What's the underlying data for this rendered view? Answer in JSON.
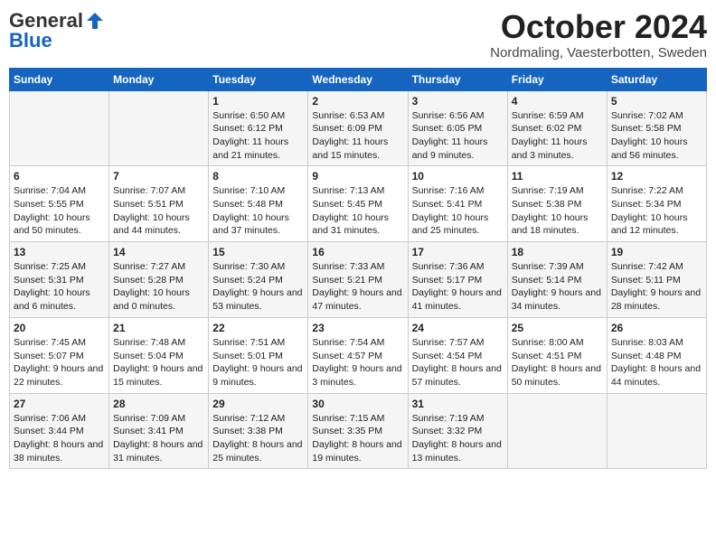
{
  "logo": {
    "general": "General",
    "blue": "Blue"
  },
  "title": "October 2024",
  "location": "Nordmaling, Vaesterbotten, Sweden",
  "days_of_week": [
    "Sunday",
    "Monday",
    "Tuesday",
    "Wednesday",
    "Thursday",
    "Friday",
    "Saturday"
  ],
  "weeks": [
    [
      {
        "day": "",
        "content": ""
      },
      {
        "day": "",
        "content": ""
      },
      {
        "day": "1",
        "content": "Sunrise: 6:50 AM\nSunset: 6:12 PM\nDaylight: 11 hours and 21 minutes."
      },
      {
        "day": "2",
        "content": "Sunrise: 6:53 AM\nSunset: 6:09 PM\nDaylight: 11 hours and 15 minutes."
      },
      {
        "day": "3",
        "content": "Sunrise: 6:56 AM\nSunset: 6:05 PM\nDaylight: 11 hours and 9 minutes."
      },
      {
        "day": "4",
        "content": "Sunrise: 6:59 AM\nSunset: 6:02 PM\nDaylight: 11 hours and 3 minutes."
      },
      {
        "day": "5",
        "content": "Sunrise: 7:02 AM\nSunset: 5:58 PM\nDaylight: 10 hours and 56 minutes."
      }
    ],
    [
      {
        "day": "6",
        "content": "Sunrise: 7:04 AM\nSunset: 5:55 PM\nDaylight: 10 hours and 50 minutes."
      },
      {
        "day": "7",
        "content": "Sunrise: 7:07 AM\nSunset: 5:51 PM\nDaylight: 10 hours and 44 minutes."
      },
      {
        "day": "8",
        "content": "Sunrise: 7:10 AM\nSunset: 5:48 PM\nDaylight: 10 hours and 37 minutes."
      },
      {
        "day": "9",
        "content": "Sunrise: 7:13 AM\nSunset: 5:45 PM\nDaylight: 10 hours and 31 minutes."
      },
      {
        "day": "10",
        "content": "Sunrise: 7:16 AM\nSunset: 5:41 PM\nDaylight: 10 hours and 25 minutes."
      },
      {
        "day": "11",
        "content": "Sunrise: 7:19 AM\nSunset: 5:38 PM\nDaylight: 10 hours and 18 minutes."
      },
      {
        "day": "12",
        "content": "Sunrise: 7:22 AM\nSunset: 5:34 PM\nDaylight: 10 hours and 12 minutes."
      }
    ],
    [
      {
        "day": "13",
        "content": "Sunrise: 7:25 AM\nSunset: 5:31 PM\nDaylight: 10 hours and 6 minutes."
      },
      {
        "day": "14",
        "content": "Sunrise: 7:27 AM\nSunset: 5:28 PM\nDaylight: 10 hours and 0 minutes."
      },
      {
        "day": "15",
        "content": "Sunrise: 7:30 AM\nSunset: 5:24 PM\nDaylight: 9 hours and 53 minutes."
      },
      {
        "day": "16",
        "content": "Sunrise: 7:33 AM\nSunset: 5:21 PM\nDaylight: 9 hours and 47 minutes."
      },
      {
        "day": "17",
        "content": "Sunrise: 7:36 AM\nSunset: 5:17 PM\nDaylight: 9 hours and 41 minutes."
      },
      {
        "day": "18",
        "content": "Sunrise: 7:39 AM\nSunset: 5:14 PM\nDaylight: 9 hours and 34 minutes."
      },
      {
        "day": "19",
        "content": "Sunrise: 7:42 AM\nSunset: 5:11 PM\nDaylight: 9 hours and 28 minutes."
      }
    ],
    [
      {
        "day": "20",
        "content": "Sunrise: 7:45 AM\nSunset: 5:07 PM\nDaylight: 9 hours and 22 minutes."
      },
      {
        "day": "21",
        "content": "Sunrise: 7:48 AM\nSunset: 5:04 PM\nDaylight: 9 hours and 15 minutes."
      },
      {
        "day": "22",
        "content": "Sunrise: 7:51 AM\nSunset: 5:01 PM\nDaylight: 9 hours and 9 minutes."
      },
      {
        "day": "23",
        "content": "Sunrise: 7:54 AM\nSunset: 4:57 PM\nDaylight: 9 hours and 3 minutes."
      },
      {
        "day": "24",
        "content": "Sunrise: 7:57 AM\nSunset: 4:54 PM\nDaylight: 8 hours and 57 minutes."
      },
      {
        "day": "25",
        "content": "Sunrise: 8:00 AM\nSunset: 4:51 PM\nDaylight: 8 hours and 50 minutes."
      },
      {
        "day": "26",
        "content": "Sunrise: 8:03 AM\nSunset: 4:48 PM\nDaylight: 8 hours and 44 minutes."
      }
    ],
    [
      {
        "day": "27",
        "content": "Sunrise: 7:06 AM\nSunset: 3:44 PM\nDaylight: 8 hours and 38 minutes."
      },
      {
        "day": "28",
        "content": "Sunrise: 7:09 AM\nSunset: 3:41 PM\nDaylight: 8 hours and 31 minutes."
      },
      {
        "day": "29",
        "content": "Sunrise: 7:12 AM\nSunset: 3:38 PM\nDaylight: 8 hours and 25 minutes."
      },
      {
        "day": "30",
        "content": "Sunrise: 7:15 AM\nSunset: 3:35 PM\nDaylight: 8 hours and 19 minutes."
      },
      {
        "day": "31",
        "content": "Sunrise: 7:19 AM\nSunset: 3:32 PM\nDaylight: 8 hours and 13 minutes."
      },
      {
        "day": "",
        "content": ""
      },
      {
        "day": "",
        "content": ""
      }
    ]
  ]
}
